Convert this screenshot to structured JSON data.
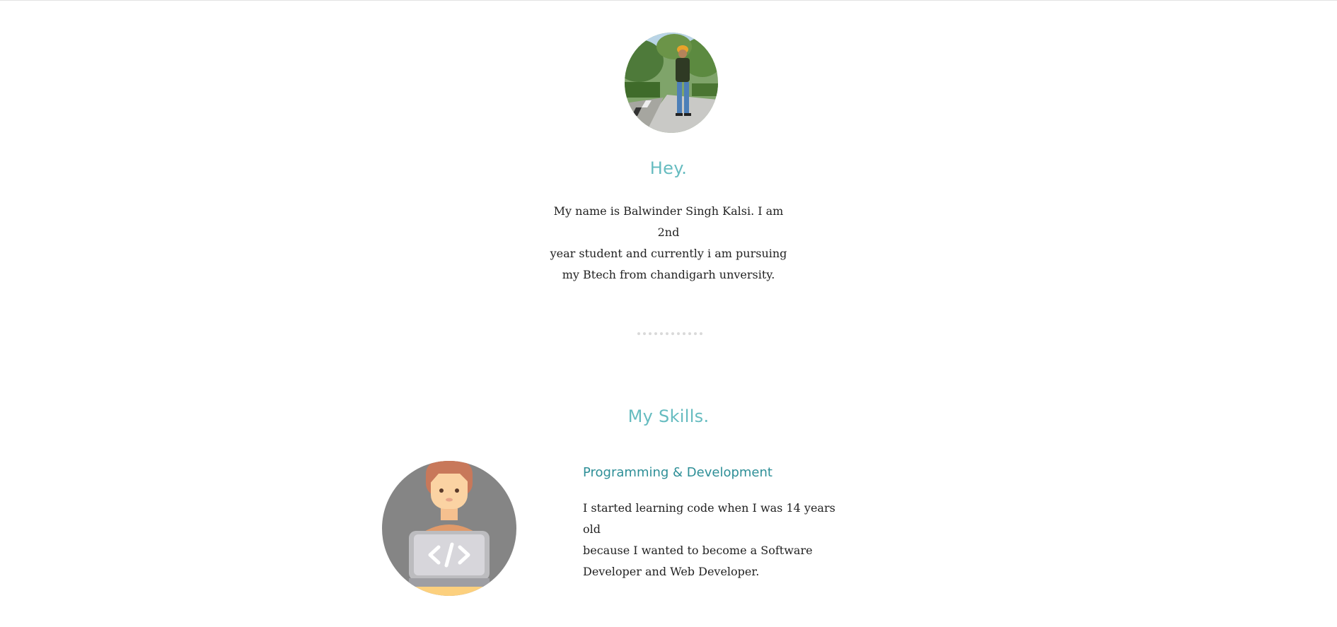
{
  "about": {
    "avatar_alt": "profile photo",
    "title": "Hey.",
    "line1": "My name is Balwinder Singh Kalsi. I am 2nd",
    "line2": "year student and currently i am pursuing",
    "line3": "my Btech from chandigarh unversity."
  },
  "skills": {
    "title": "My Skills.",
    "items": [
      {
        "icon": "developer-laptop-icon",
        "heading": "Programming & Development",
        "line1": "I started learning code when I was 14 years old",
        "line2": "because I wanted to become a Software",
        "line3": "Developer and Web Developer."
      }
    ]
  },
  "colors": {
    "accent": "#66bcc0",
    "accent_dark": "#2e8f97",
    "text": "#222222",
    "divider_dot": "#d9d9d9"
  }
}
